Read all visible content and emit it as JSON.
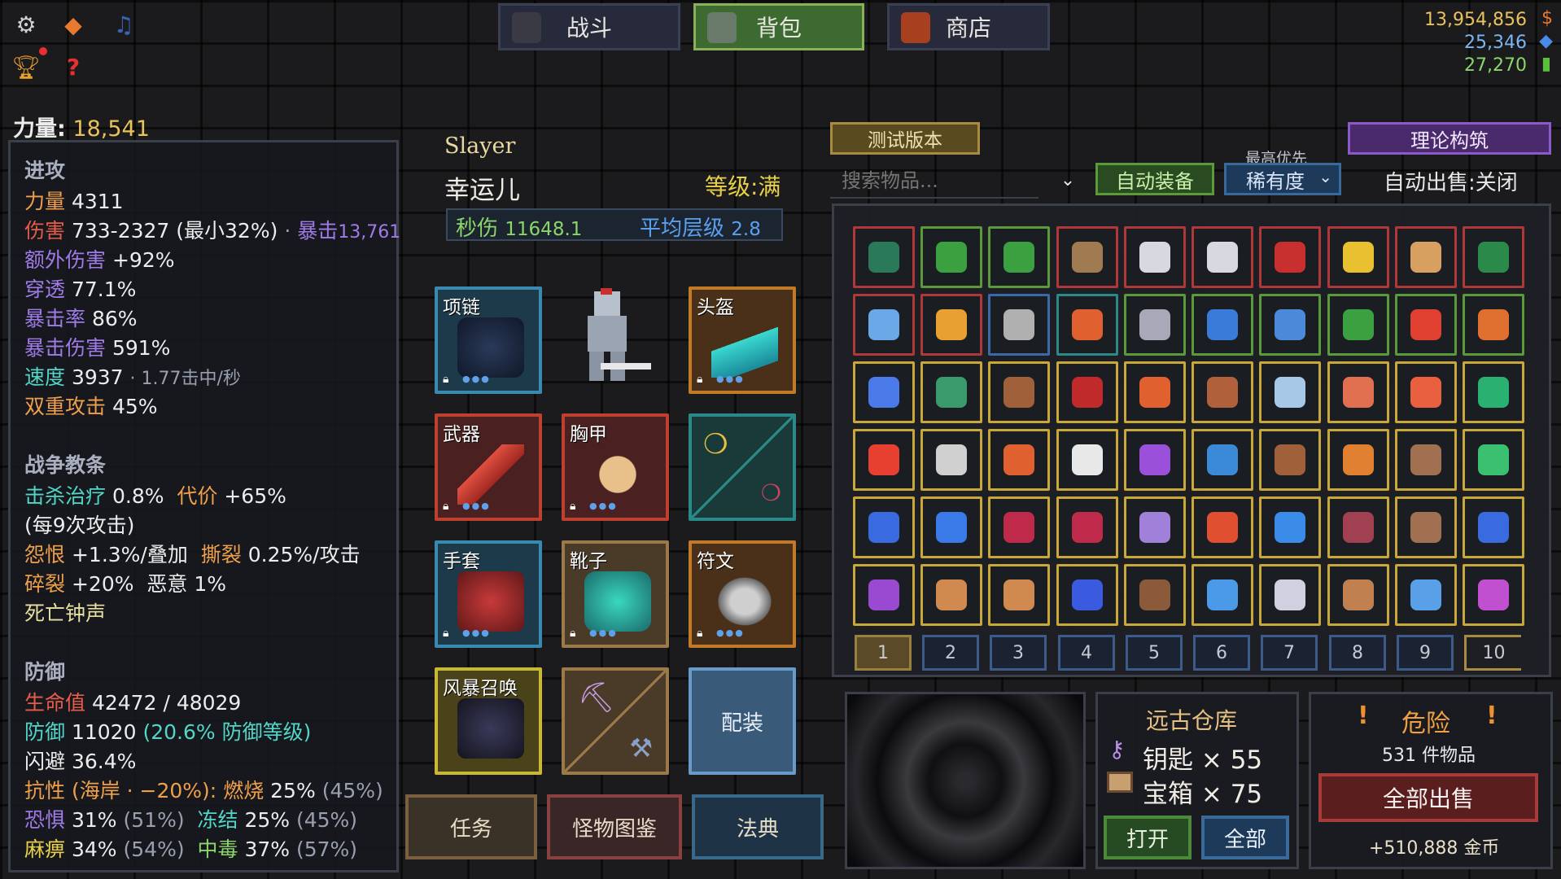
{
  "topbar": {
    "tabs": [
      {
        "label": "战斗"
      },
      {
        "label": "背包"
      },
      {
        "label": "商店"
      }
    ],
    "currency": {
      "gold": "13,954,856",
      "gems": "25,346",
      "cells": "27,270"
    }
  },
  "strength_header": {
    "label": "力量",
    "value": "18,541"
  },
  "stats": {
    "offense_title": "进攻",
    "strength": {
      "label": "力量",
      "value": "4311"
    },
    "damage": {
      "label": "伤害",
      "value": "733-2327 (最小32%)",
      "sep": "·",
      "crit_label": "暴击",
      "crit_value": "13,761"
    },
    "extra_damage": {
      "label": "额外伤害",
      "value": "+92%"
    },
    "penetration": {
      "label": "穿透",
      "value": "77.1%"
    },
    "crit_rate": {
      "label": "暴击率",
      "value": "86%"
    },
    "crit_damage": {
      "label": "暴击伤害",
      "value": "591%"
    },
    "speed": {
      "label": "速度",
      "value": "3937",
      "sub": "· 1.77击中/秒"
    },
    "double_attack": {
      "label": "双重攻击",
      "value": "45%"
    },
    "doctrine_title": "战争教条",
    "kill_heal": {
      "label": "击杀治疗",
      "value": "0.8%",
      "cost_label": "代价",
      "cost_value": "+65%"
    },
    "per_attack": "(每9次攻击)",
    "spite": {
      "label": "怨恨",
      "value": "+1.3%/叠加",
      "tear_label": "撕裂",
      "tear_value": "0.25%/攻击"
    },
    "shatter": {
      "label": "碎裂",
      "value": "+20%",
      "malice": "恶意 1%"
    },
    "death_bell": "死亡钟声",
    "defense_title": "防御",
    "hp": {
      "label": "生命值",
      "value": "42472 / 48029"
    },
    "defense": {
      "label": "防御",
      "value": "11020",
      "extra": "(20.6% 防御等级)"
    },
    "dodge": {
      "label": "闪避",
      "value": "36.4%"
    },
    "resist": {
      "label": "抗性 (海岸 · −20%):",
      "burn_label": "燃烧",
      "burn_value": "25%",
      "burn_max": "(45%)"
    },
    "fear": {
      "label": "恐惧",
      "value": "31%",
      "max": "(51%)",
      "freeze_label": "冻结",
      "freeze_value": "25%",
      "freeze_max": "(45%)"
    },
    "paralysis": {
      "label": "麻痹",
      "value": "34%",
      "max": "(54%)",
      "poison_label": "中毒",
      "poison_value": "37%",
      "poison_max": "(57%)"
    }
  },
  "character": {
    "class": "Slayer",
    "name": "幸运儿",
    "level": "等级:满",
    "dps_label": "秒伤",
    "dps_value": "11648.1",
    "avg_label": "平均层级",
    "avg_value": "2.8"
  },
  "slots": {
    "necklace": "项链",
    "helmet": "头盔",
    "weapon": "武器",
    "chest": "胸甲",
    "gloves": "手套",
    "boots": "靴子",
    "rune": "符文",
    "storm": "风暴召唤",
    "loadout": "配装"
  },
  "bottom_buttons": {
    "quest": "任务",
    "bestiary": "怪物图鉴",
    "codex": "法典"
  },
  "inventory": {
    "test_version": "测试版本",
    "theory_build": "理论构筑",
    "search_placeholder": "搜索物品...",
    "auto_equip": "自动装备",
    "priority_caption": "最高优先",
    "priority_value": "稀有度",
    "auto_sell": "自动出售:关闭",
    "pages": [
      "1",
      "2",
      "3",
      "4",
      "5",
      "6",
      "7",
      "8",
      "9",
      "10"
    ]
  },
  "vault": {
    "title": "远古仓库",
    "keys_label": "钥匙",
    "keys_value": "× 55",
    "chests_label": "宝箱",
    "chests_value": "× 75",
    "open": "打开",
    "all": "全部"
  },
  "danger": {
    "title": "危险",
    "mark": "!",
    "count": "531 件物品",
    "sell_all": "全部出售",
    "gold": "+510,888 金币"
  },
  "colors": {
    "rare": "#5a9a3a",
    "legendary": "#c8a838",
    "epic": "#b03838",
    "set": "#2a8a8a",
    "magic": "#3a6aa8"
  }
}
